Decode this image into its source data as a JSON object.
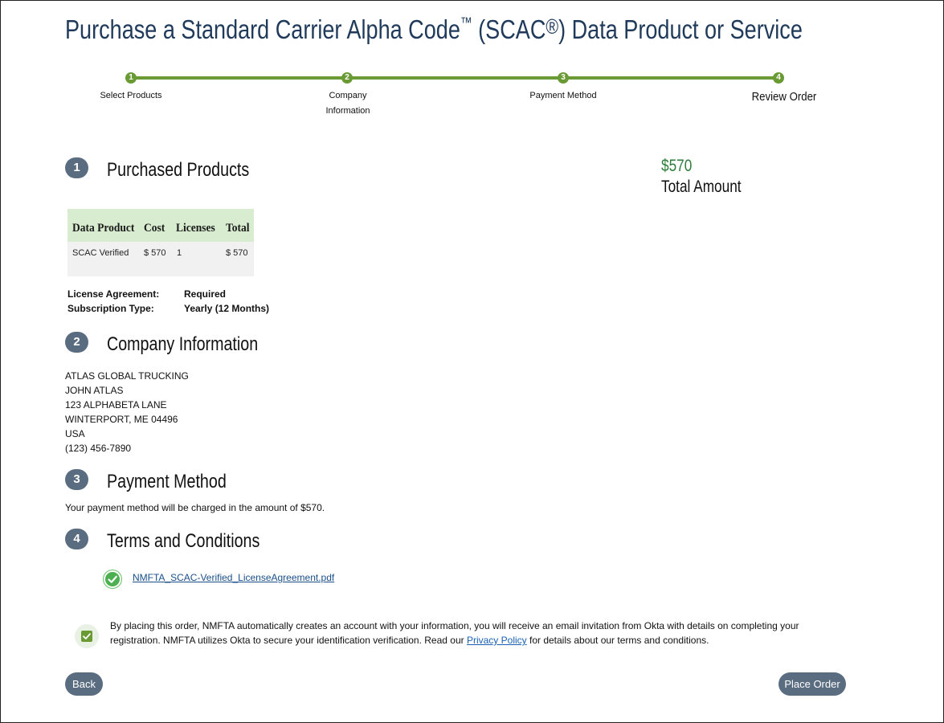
{
  "page": {
    "title_main": "Purchase a Standard Carrier Alpha Code",
    "title_tm": "™",
    "title_scac": " (SCAC",
    "title_reg": "®",
    "title_rest": ") Data Product or Service"
  },
  "steps": [
    {
      "num": "1",
      "label": "Select Products"
    },
    {
      "num": "2",
      "label_line1": "Company",
      "label_line2": "Information"
    },
    {
      "num": "3",
      "label": "Payment Method"
    },
    {
      "num": "4",
      "label": "Review Order"
    }
  ],
  "sections": {
    "products": {
      "num": "1",
      "title": "Purchased Products"
    },
    "company": {
      "num": "2",
      "title": "Company Information"
    },
    "payment": {
      "num": "3",
      "title": "Payment Method"
    },
    "terms": {
      "num": "4",
      "title": "Terms and Conditions"
    }
  },
  "total": {
    "amount": "$570",
    "label": "Total Amount"
  },
  "product_table": {
    "headers": [
      "Data Product",
      "Cost",
      "Licenses",
      "Total"
    ],
    "rows": [
      [
        "SCAC Verified",
        "$ 570",
        "1",
        "$ 570"
      ]
    ]
  },
  "license": {
    "agreement_label": "License Agreement:",
    "agreement_value": "Required",
    "subscription_label": "Subscription Type:",
    "subscription_value": "Yearly (12 Months)"
  },
  "company_info": [
    "ATLAS GLOBAL TRUCKING",
    "JOHN ATLAS",
    "123 ALPHABETA LANE",
    "WINTERPORT, ME 04496",
    "USA",
    "(123) 456-7890"
  ],
  "payment": {
    "text": "Your payment method will be charged in the amount of $570."
  },
  "terms": {
    "pdf_link": "NMFTA_SCAC-Verified_LicenseAgreement.pdf"
  },
  "agreement": {
    "text_before": "By placing this order, NMFTA automatically creates an account with your information, you will receive an email invitation from Okta with details on completing your registration. NMFTA utilizes Okta to secure your identification verification. Read our ",
    "link": "Privacy Policy",
    "text_after": " for details about our terms and conditions.",
    "checked": true
  },
  "buttons": {
    "back": "Back",
    "place_order": "Place Order"
  },
  "colors": {
    "title": "#1f3a5a",
    "accent_green": "#6a9a34",
    "badge": "#5a6c80",
    "total_green": "#2e7d3c"
  }
}
